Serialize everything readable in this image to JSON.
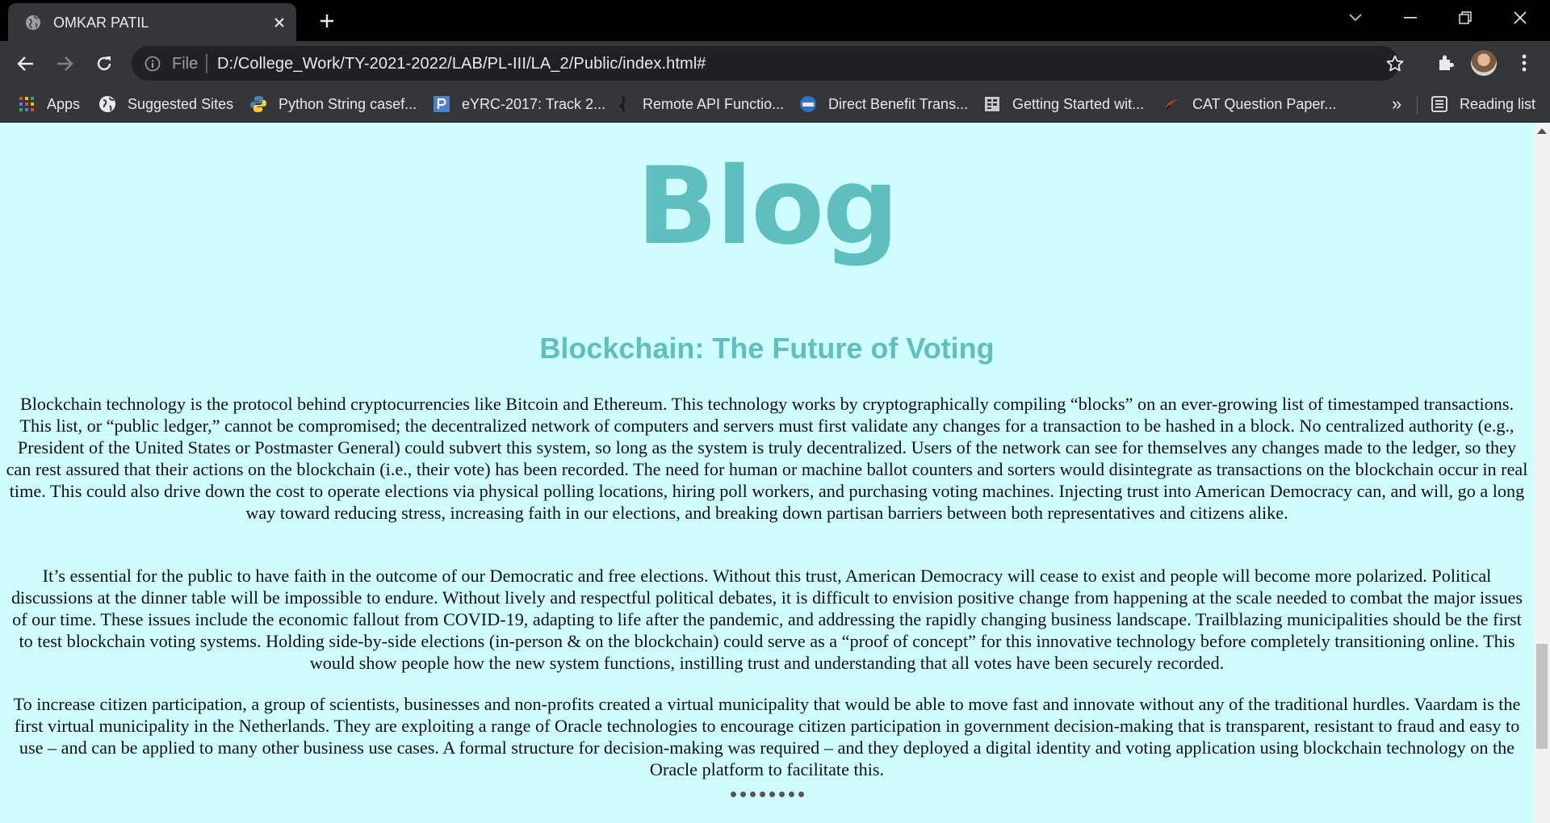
{
  "browser": {
    "tab_title": "OMKAR PATIL",
    "omnibox": {
      "scheme_label": "File",
      "url": "D:/College_Work/TY-2021-2022/LAB/PL-III/LA_2/Public/index.html#"
    },
    "bookmarks": [
      {
        "label": "Apps",
        "icon": "apps-grid-icon"
      },
      {
        "label": "Suggested Sites",
        "icon": "globe-icon"
      },
      {
        "label": "Python String casef...",
        "icon": "python-icon"
      },
      {
        "label": "eYRC-2017: Track 2...",
        "icon": "p-icon"
      },
      {
        "label": "Remote API Functio...",
        "icon": "robot-icon"
      },
      {
        "label": "Direct Benefit Trans...",
        "icon": "dbt-icon"
      },
      {
        "label": "Getting Started wit...",
        "icon": "doc-icon"
      },
      {
        "label": "CAT Question Paper...",
        "icon": "cat-icon"
      }
    ],
    "overflow_label": "»",
    "reading_list_label": "Reading list"
  },
  "page": {
    "heading": "Blog",
    "article_title": "Blockchain: The Future of Voting",
    "paragraphs": [
      "Blockchain technology is the protocol behind cryptocurrencies like Bitcoin and Ethereum. This technology works by cryptographically compiling “blocks” on an ever-growing list of timestamped transactions. This list, or “public ledger,” cannot be compromised; the decentralized network of computers and servers must first validate any changes for a transaction to be hashed in a block. No centralized authority (e.g., President of the United States or Postmaster General) could subvert this system, so long as the system is truly decentralized. Users of the network can see for themselves any changes made to the ledger, so they can rest assured that their actions on the blockchain (i.e., their vote) has been recorded. The need for human or machine ballot counters and sorters would disintegrate as transactions on the blockchain occur in real time. This could also drive down the cost to operate elections via physical polling locations, hiring poll workers, and purchasing voting machines. Injecting trust into American Democracy can, and will, go a long way toward reducing stress, increasing faith in our elections, and breaking down partisan barriers between both representatives and citizens alike.",
      "It’s essential for the public to have faith in the outcome of our Democratic and free elections. Without this trust, American Democracy will cease to exist and people will become more polarized. Political discussions at the dinner table will be impossible to endure. Without lively and respectful political debates, it is difficult to envision positive change from happening at the scale needed to combat the major issues of our time. These issues include the economic fallout from COVID-19, adapting to life after the pandemic, and addressing the rapidly changing business landscape. Trailblazing municipalities should be the first to test blockchain voting systems. Holding side-by-side elections (in-person & on the blockchain) could serve as a “proof of concept” for this innovative technology before completely transitioning online. This would show people how the new system functions, instilling trust and understanding that all votes have been securely recorded.",
      "To increase citizen participation, a group of scientists, businesses and non-profits created a virtual municipality that would be able to move fast and innovate without any of the traditional hurdles. Vaardam is the first virtual municipality in the Netherlands. They are exploiting a range of Oracle technologies to encourage citizen participation in government decision-making that is transparent, resistant to fraud and easy to use – and can be applied to many other business use cases. A formal structure for decision-making was required – and they deployed a digital identity and voting application using blockchain technology on the Oracle platform to facilitate this."
    ]
  },
  "colors": {
    "page_background": "#cffcfc",
    "heading_accent": "#5fbfbf",
    "browser_chrome": "#35363a"
  }
}
